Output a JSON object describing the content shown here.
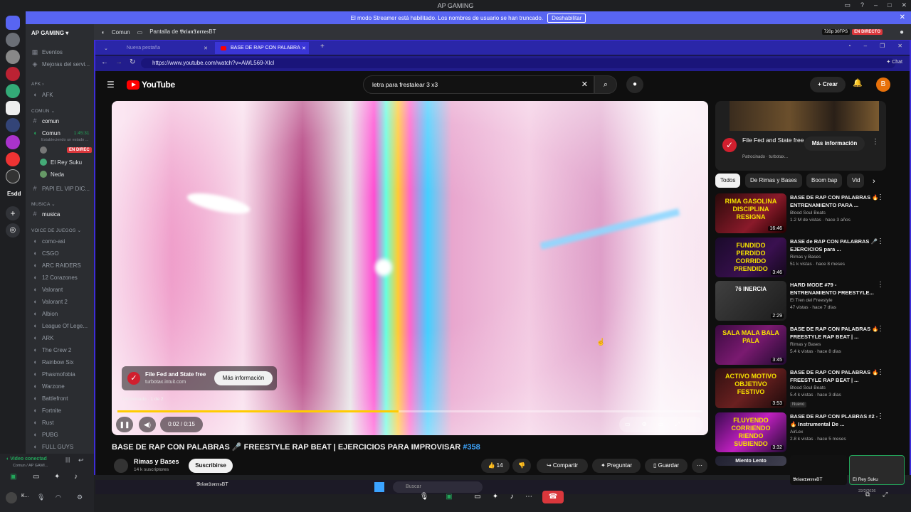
{
  "window": {
    "title": "AP GAMING"
  },
  "banner": {
    "text": "El modo Streamer está habilitado. Los nombres de usuario se han truncado.",
    "button": "Deshabilitar"
  },
  "rail": {
    "label": "Esdd"
  },
  "server": {
    "name": "AP GAMING"
  },
  "sidebar": {
    "top_items": [
      "Eventos",
      "Mejoras del servi..."
    ],
    "categories": {
      "afk": "AFK",
      "comun": "COMUN",
      "musica": "MUSICA",
      "voice": "VOICE DE JUEGOS"
    },
    "afk_channel": "AFK",
    "comun_text": "comun",
    "comun_voice": "Comun",
    "comun_timer": "1:45:31",
    "comun_status": "Estableciendo un estado ...",
    "voice_members": [
      {
        "name": "",
        "live": "EN DIREC"
      },
      {
        "name": "El Rey Suku"
      },
      {
        "name": "Neda"
      }
    ],
    "papi": "PAPI EL VIP DIC...",
    "musica_channel": "musica",
    "voice_channels": [
      "como-asi",
      "CSGO",
      "ARC RAIDERS",
      "12 Corazones",
      "Valorant",
      "Valorant 2",
      "Albion",
      "League Of Lege...",
      "ARK",
      "The Crew 2",
      "Rainbow Six",
      "Phasmofobia",
      "Warzone",
      "Battlefront",
      "Fortnite",
      "Rust",
      "PUBG",
      "FULL GUYS"
    ]
  },
  "voice_panel": {
    "status": "Video conectad",
    "sub": "Comun / AP GAMI...",
    "user": "K..."
  },
  "topbar": {
    "channel": "Comun",
    "screen": "Pantalla de 𝕭𝖗𝖎𝖆𝖓𝕿𝖔𝖗𝖗𝖊𝖘BT",
    "quality": "720p 30FPS",
    "live": "EN DIRECTO"
  },
  "browser": {
    "tabs": [
      "Nueva pestaña",
      "BASE DE RAP CON PALABRA"
    ],
    "url": "https://www.youtube.com/watch?v=AWL569-Xlcl",
    "chat_label": "Chat"
  },
  "youtube": {
    "logo": "YouTube",
    "search": "letra para frestalear 3 x3",
    "create": "Crear",
    "avatar": "B",
    "ad": {
      "title": "File Fed and State free",
      "domain": "turbotax.intuit.com",
      "cta": "Más información",
      "sponsored": "Patrocinado · 1 de 2"
    },
    "player": {
      "time": "0:02 / 0:15",
      "progress": 0.48
    },
    "video_title": "BASE DE RAP CON PALABRAS 🎤 FREESTYLE RAP BEAT | EJERCICIOS PARA IMPROVISAR ",
    "video_tag": "#358",
    "channel": {
      "name": "Rimas y Bases",
      "subs": "14 k suscriptores",
      "subscribe": "Suscribirse"
    },
    "actions": {
      "likes": "14",
      "share": "Compartir",
      "ask": "Preguntar",
      "save": "Guardar"
    },
    "side_ad": {
      "title": "File Fed and State free",
      "sponsor": "Patrocinado · turbotax...",
      "cta": "Más información"
    },
    "chips": [
      "Todos",
      "De Rimas y Bases",
      "Boom bap",
      "Vid"
    ],
    "recs": [
      {
        "thumb": "RIMA GASOLINA DISCIPLINA RESIGNA",
        "dur": "16:46",
        "title": "BASE DE RAP CON PALABRAS 🔥 ENTRENAMIENTO PARA ...",
        "channel": "Blood Soul Beats",
        "meta": "1.2 M de vistas · hace 3 años"
      },
      {
        "thumb": "FUNDIDO PERDIDO CORRIDO PRENDIDO",
        "dur": "3:46",
        "title": "BASE de RAP CON PALABRAS 🎤 EJERCICIOS para ...",
        "channel": "Rimas y Bases",
        "meta": "51 k vistas · hace 8 meses"
      },
      {
        "thumb": "76 INERCIA",
        "dur": "2:29",
        "title": "HARD MODE #79 - ENTRENAMIENTO FREESTYLE...",
        "channel": "El Tren del Freestyle",
        "meta": "47 vistas · hace 7 días"
      },
      {
        "thumb": "SALA MALA BALA PALA",
        "dur": "3:45",
        "title": "BASE DE RAP CON PALABRAS 🔥 FREESTYLE RAP BEAT | ...",
        "channel": "Rimas y Bases",
        "meta": "5.4 k vistas · hace 8 días"
      },
      {
        "thumb": "ACTIVO MOTIVO OBJETIVO FESTIVO",
        "dur": "3:53",
        "title": "BASE DE RAP CON PALABRAS 🔥 FREESTYLE RAP BEAT | ...",
        "channel": "Blood Soul Beats",
        "meta": "5.4 k vistas · hace 3 días",
        "badge": "Nuevo"
      },
      {
        "thumb": "FLUYENDO CORRIENDO RIENDO SUBIENDO",
        "dur": "3:32",
        "title": "BASE DE RAP CON PLABRAS #2 - 🔥 Instrumental De ...",
        "channel": "AirLex",
        "meta": "2.8 k vistas · hace 5 meses"
      },
      {
        "thumb": "Miento Lento",
        "dur": "",
        "title": "",
        "channel": "",
        "meta": ""
      }
    ]
  },
  "taskbar": {
    "search": "Buscar"
  },
  "call": {
    "tiles": [
      "𝕭𝖗𝖎𝖆𝖓𝕿𝖔𝖗𝖗𝖊𝖘BT",
      "El Rey Suku"
    ],
    "clock": "22/2/2026"
  },
  "colors": {
    "discord_blurple": "#5865f2",
    "live_red": "#da373c",
    "yt_red": "#ff0000",
    "browser_border": "#3d2dd6"
  }
}
